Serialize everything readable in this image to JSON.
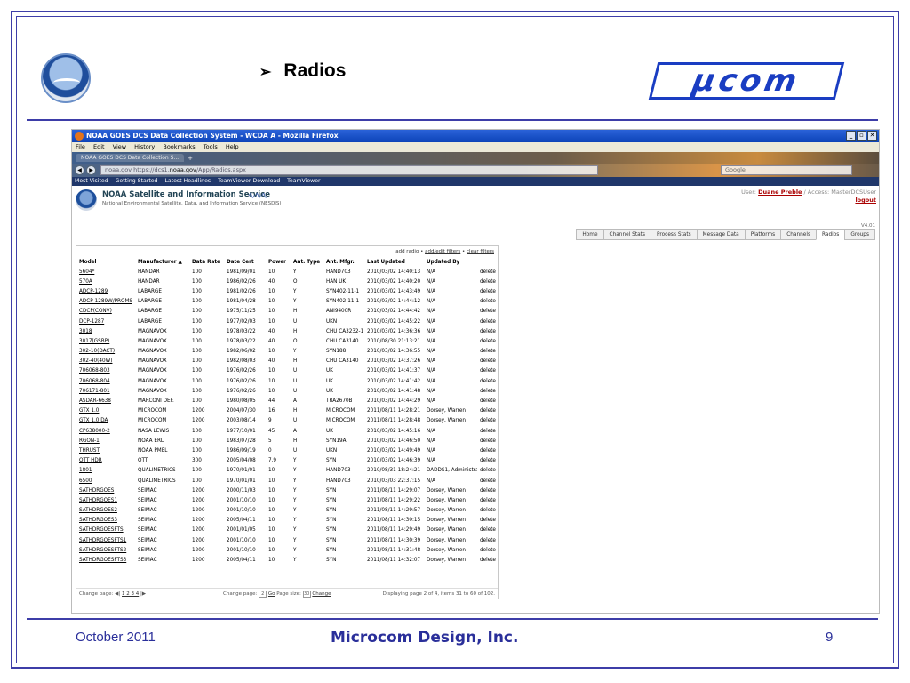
{
  "slide": {
    "title": "Radios",
    "arrow": "➢",
    "logo_text": "μcom",
    "footer_date": "October 2011",
    "footer_company": "Microcom Design, Inc.",
    "page_number": "9"
  },
  "browser": {
    "window_title": "NOAA GOES DCS Data Collection System - WCDA A - Mozilla Firefox",
    "menu": [
      "File",
      "Edit",
      "View",
      "History",
      "Bookmarks",
      "Tools",
      "Help"
    ],
    "tab_label": "NOAA GOES DCS Data Collection S...",
    "url_domain": "noaa.gov",
    "url_prefix": "https://dcs1.",
    "url_host": "noaa.gov",
    "url_path": "/App/Radios.aspx",
    "search_placeholder": "Google",
    "bookmarks": [
      "Most Visited",
      "Getting Started",
      "Latest Headlines",
      "TeamViewer Download",
      "TeamViewer"
    ]
  },
  "app": {
    "title": "NOAA Satellite and Information Service",
    "subtitle": "National Environmental Satellite, Data, and Information Service (NESDIS)",
    "user_prefix": "User:",
    "user_name": "Duane Preble",
    "access_text": "/ Access: MasterDCSUser",
    "logout": "logout",
    "version": "V4.01",
    "nav_tabs": [
      "Home",
      "Channel Stats",
      "Process Stats",
      "Message Data",
      "Platforms",
      "Channels",
      "Radios",
      "Groups"
    ],
    "active_tab": "Radios"
  },
  "grid": {
    "actions": {
      "add": "add radio",
      "sep1": " • ",
      "edit": "add/edit filters",
      "sep2": " • ",
      "clear": "clear filters"
    },
    "headers": [
      "Model",
      "Manufacturer ▲",
      "Data Rate",
      "Date Cert",
      "Power",
      "Ant. Type",
      "Ant. Mfgr.",
      "Last Updated",
      "Updated By",
      ""
    ],
    "rows": [
      [
        "5604*",
        "HANDAR",
        "100",
        "1981/09/01",
        "10",
        "Y",
        "HAND703",
        "2010/03/02 14:40:13",
        "N/A",
        "delete"
      ],
      [
        "570A",
        "HANDAR",
        "100",
        "1986/02/26",
        "40",
        "O",
        "HAN UK",
        "2010/03/02 14:40:20",
        "N/A",
        "delete"
      ],
      [
        "ADCP-1289",
        "LABARGE",
        "100",
        "1981/02/26",
        "10",
        "Y",
        "SYN402-11-1",
        "2010/03/02 14:43:49",
        "N/A",
        "delete"
      ],
      [
        "ADCP-1289W/PROMS",
        "LABARGE",
        "100",
        "1981/04/28",
        "10",
        "Y",
        "SYN402-11-1",
        "2010/03/02 14:44:12",
        "N/A",
        "delete"
      ],
      [
        "CDCP(CONV)",
        "LABARGE",
        "100",
        "1975/11/25",
        "10",
        "H",
        "ANI9400R",
        "2010/03/02 14:44:42",
        "N/A",
        "delete"
      ],
      [
        "DCP-1287",
        "LABARGE",
        "100",
        "1977/02/03",
        "10",
        "U",
        "UKN",
        "2010/03/02 14:45:22",
        "N/A",
        "delete"
      ],
      [
        "3018",
        "MAGNAVOX",
        "100",
        "1978/03/22",
        "40",
        "H",
        "CHU CA3232-1",
        "2010/03/02 14:36:36",
        "N/A",
        "delete"
      ],
      [
        "3017(GSBP)",
        "MAGNAVOX",
        "100",
        "1978/03/22",
        "40",
        "O",
        "CHU CA3140",
        "2010/08/30 21:13:21",
        "N/A",
        "delete"
      ],
      [
        "302-10(DACT)",
        "MAGNAVOX",
        "100",
        "1982/06/02",
        "10",
        "Y",
        "SYN188",
        "2010/03/02 14:36:55",
        "N/A",
        "delete"
      ],
      [
        "302-40(40W)",
        "MAGNAVOX",
        "100",
        "1982/08/03",
        "40",
        "H",
        "CHU CA3140",
        "2010/03/02 14:37:26",
        "N/A",
        "delete"
      ],
      [
        "706068-803",
        "MAGNAVOX",
        "100",
        "1976/02/26",
        "10",
        "U",
        "UK",
        "2010/03/02 14:41:37",
        "N/A",
        "delete"
      ],
      [
        "706068-804",
        "MAGNAVOX",
        "100",
        "1976/02/26",
        "10",
        "U",
        "UK",
        "2010/03/02 14:41:42",
        "N/A",
        "delete"
      ],
      [
        "706171-801",
        "MAGNAVOX",
        "100",
        "1976/02/26",
        "10",
        "U",
        "UK",
        "2010/03/02 14:41:48",
        "N/A",
        "delete"
      ],
      [
        "ASDAR-6638",
        "MARCONI DEF.",
        "100",
        "1980/08/05",
        "44",
        "A",
        "TRA2670B",
        "2010/03/02 14:44:29",
        "N/A",
        "delete"
      ],
      [
        "GTX 1.0",
        "MICROCOM",
        "1200",
        "2004/07/30",
        "16",
        "H",
        "MICROCOM",
        "2011/08/11 14:28:21",
        "Dorsey, Warren",
        "delete"
      ],
      [
        "GTX 1.0 DA",
        "MICROCOM",
        "1200",
        "2003/08/14",
        "9",
        "U",
        "MICROCOM",
        "2011/08/11 14:28:48",
        "Dorsey, Warren",
        "delete"
      ],
      [
        "CP638000-2",
        "NASA LEWIS",
        "100",
        "1977/10/01",
        "45",
        "A",
        "UK",
        "2010/03/02 14:45:16",
        "N/A",
        "delete"
      ],
      [
        "RGON-1",
        "NOAA ERL",
        "100",
        "1983/07/28",
        "5",
        "H",
        "SYN19A",
        "2010/03/02 14:46:50",
        "N/A",
        "delete"
      ],
      [
        "THRUST",
        "NOAA PMEL",
        "100",
        "1986/09/19",
        "0",
        "U",
        "UKN",
        "2010/03/02 14:49:49",
        "N/A",
        "delete"
      ],
      [
        "OTT HDR",
        "OTT",
        "300",
        "2005/04/08",
        "7.9",
        "Y",
        "SYN",
        "2010/03/02 14:46:39",
        "N/A",
        "delete"
      ],
      [
        "1801",
        "QUALIMETRICS",
        "100",
        "1970/01/01",
        "10",
        "Y",
        "HAND703",
        "2010/08/31 18:24:21",
        "DADDS1, Administrator",
        "delete"
      ],
      [
        "6500",
        "QUALIMETRICS",
        "100",
        "1970/01/01",
        "10",
        "Y",
        "HAND703",
        "2010/03/03 22:37:15",
        "N/A",
        "delete"
      ],
      [
        "SATHDRGOES",
        "SEIMAC",
        "1200",
        "2000/11/03",
        "10",
        "Y",
        "SYN",
        "2011/08/11 14:29:07",
        "Dorsey, Warren",
        "delete"
      ],
      [
        "SATHDRGOES1",
        "SEIMAC",
        "1200",
        "2001/10/10",
        "10",
        "Y",
        "SYN",
        "2011/08/11 14:29:22",
        "Dorsey, Warren",
        "delete"
      ],
      [
        "SATHDRGOES2",
        "SEIMAC",
        "1200",
        "2001/10/10",
        "10",
        "Y",
        "SYN",
        "2011/08/11 14:29:57",
        "Dorsey, Warren",
        "delete"
      ],
      [
        "SATHDRGOES3",
        "SEIMAC",
        "1200",
        "2005/04/11",
        "10",
        "Y",
        "SYN",
        "2011/08/11 14:30:15",
        "Dorsey, Warren",
        "delete"
      ],
      [
        "SATHDRGOESFTS",
        "SEIMAC",
        "1200",
        "2001/01/05",
        "10",
        "Y",
        "SYN",
        "2011/08/11 14:29:49",
        "Dorsey, Warren",
        "delete"
      ],
      [
        "SATHDRGOESFTS1",
        "SEIMAC",
        "1200",
        "2001/10/10",
        "10",
        "Y",
        "SYN",
        "2011/08/11 14:30:39",
        "Dorsey, Warren",
        "delete"
      ],
      [
        "SATHDRGOESFTS2",
        "SEIMAC",
        "1200",
        "2001/10/10",
        "10",
        "Y",
        "SYN",
        "2011/08/11 14:31:48",
        "Dorsey, Warren",
        "delete"
      ],
      [
        "SATHDRGOESFTS3",
        "SEIMAC",
        "1200",
        "2005/04/11",
        "10",
        "Y",
        "SYN",
        "2011/08/11 14:32:07",
        "Dorsey, Warren",
        "delete"
      ]
    ],
    "footer": {
      "change_page_label": "Change page:",
      "pages": "1 2 3 4",
      "change_page_mid": "Change page:",
      "page_value": "2",
      "go": "Go",
      "page_size_label": "Page size:",
      "page_size_value": "30",
      "change": "Change",
      "status": "Displaying page 2 of 4, items 31 to 60 of 102."
    }
  }
}
